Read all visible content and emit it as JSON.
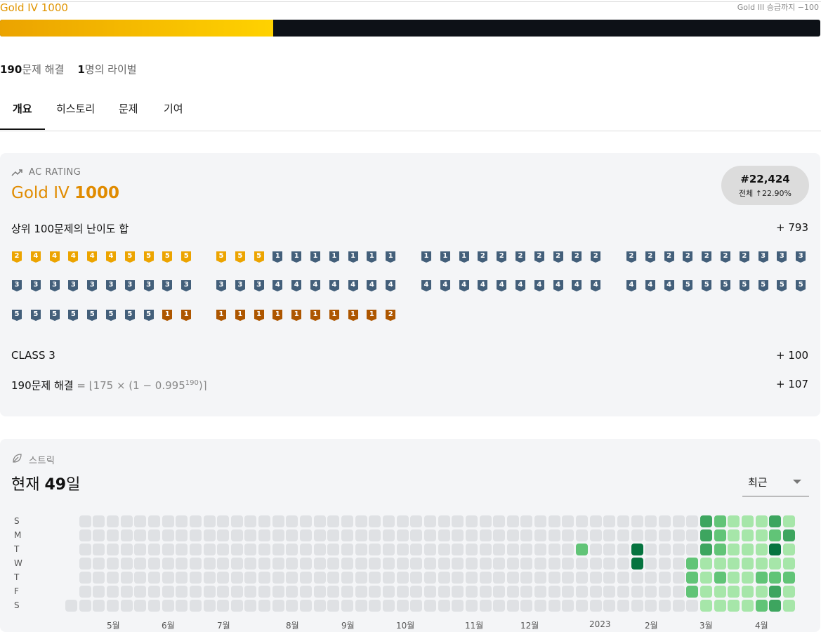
{
  "header": {
    "tier_name": "Gold IV",
    "tier_rating": "1000",
    "next_tier": "Gold III 승급까지 −100",
    "progress_fraction": 0.333,
    "solved_count": "190",
    "solved_label": "문제 해결",
    "rival_count": "1",
    "rival_label": "명의 라이벌"
  },
  "tabs": [
    {
      "label": "개요",
      "active": true
    },
    {
      "label": "히스토리",
      "active": false
    },
    {
      "label": "문제",
      "active": false
    },
    {
      "label": "기여",
      "active": false
    }
  ],
  "ac_rating": {
    "section_label": "AC RATING",
    "tier_name": "Gold IV",
    "rating": "1000",
    "rank": "#22,424",
    "percentile": "전체 ↑22.90%",
    "top100_label": "상위 100문제의 난이도 합",
    "top100_value": "+ 793",
    "class_label": "CLASS 3",
    "class_value": "+ 100",
    "solved_label": "190문제 해결",
    "solved_formula_a": " = ⌊175 × (1 − 0.995",
    "solved_formula_exp": "190",
    "solved_formula_b": ")⌉",
    "solved_value": "+ 107"
  },
  "problem_tiers": [
    [
      "G2",
      "G4",
      "G4",
      "G4",
      "G4",
      "G4",
      "G5",
      "G5",
      "G5",
      "G5",
      "G5",
      "G5",
      "G5",
      "S1",
      "S1",
      "S1",
      "S1",
      "S1",
      "S1",
      "S1",
      "S1",
      "S1",
      "S1",
      "S2",
      "S2",
      "S2",
      "S2",
      "S2",
      "S2",
      "S2",
      "S2",
      "S2",
      "S2",
      "S2",
      "S2",
      "S2",
      "S2",
      "S3",
      "S3",
      "S3"
    ],
    [
      "S3",
      "S3",
      "S3",
      "S3",
      "S3",
      "S3",
      "S3",
      "S3",
      "S3",
      "S3",
      "S3",
      "S3",
      "S3",
      "S4",
      "S4",
      "S4",
      "S4",
      "S4",
      "S4",
      "S4",
      "S4",
      "S4",
      "S4",
      "S4",
      "S4",
      "S4",
      "S4",
      "S4",
      "S4",
      "S4",
      "S4",
      "S4",
      "S4",
      "S5",
      "S5",
      "S5",
      "S5",
      "S5",
      "S5",
      "S5"
    ],
    [
      "S5",
      "S5",
      "S5",
      "S5",
      "S5",
      "S5",
      "S5",
      "S5",
      "B1",
      "B1",
      "B1",
      "B1",
      "B1",
      "B1",
      "B1",
      "B1",
      "B1",
      "B1",
      "B1",
      "B2"
    ]
  ],
  "tier_colors": {
    "G": "#eca400",
    "S": "#435f7a",
    "B": "#ad5600"
  },
  "streak": {
    "section_label": "스트릭",
    "current_prefix": "현재 ",
    "current_days": "49",
    "current_suffix": "일",
    "select_value": "최근",
    "day_labels": [
      "S",
      "M",
      "T",
      "W",
      "T",
      "F",
      "S"
    ],
    "months": [
      "5월",
      "6월",
      "7월",
      "8월",
      "9월",
      "10월",
      "11월",
      "12월",
      "2023",
      "2월",
      "3월",
      "4월"
    ],
    "levels": {
      "0": [
        0,
        0,
        0,
        0,
        0,
        0,
        0,
        0,
        0,
        0,
        0,
        0,
        0,
        0,
        0,
        0,
        0,
        0,
        0,
        0,
        0,
        0,
        0,
        0,
        0,
        0,
        0,
        0,
        0,
        0,
        0,
        0,
        0,
        0,
        0,
        0,
        0,
        0,
        0,
        0,
        0,
        0,
        0,
        0,
        0,
        0,
        0,
        0,
        0,
        0,
        0,
        0,
        0,
        0
      ],
      "cols": [
        [
          -1,
          -1,
          -1,
          -1,
          -1,
          -1,
          0
        ],
        [
          0,
          0,
          0,
          0,
          0,
          0,
          0
        ],
        [
          0,
          0,
          0,
          0,
          0,
          0,
          0
        ],
        [
          0,
          0,
          0,
          0,
          0,
          0,
          0
        ],
        [
          0,
          0,
          0,
          0,
          0,
          0,
          0
        ],
        [
          0,
          0,
          0,
          0,
          0,
          0,
          0
        ],
        [
          0,
          0,
          0,
          0,
          0,
          0,
          0
        ],
        [
          0,
          0,
          0,
          0,
          0,
          0,
          0
        ],
        [
          0,
          0,
          0,
          0,
          0,
          0,
          0
        ],
        [
          0,
          0,
          0,
          0,
          0,
          0,
          0
        ],
        [
          0,
          0,
          0,
          0,
          0,
          0,
          0
        ],
        [
          0,
          0,
          0,
          0,
          0,
          0,
          0
        ],
        [
          0,
          0,
          0,
          0,
          0,
          0,
          0
        ],
        [
          0,
          0,
          0,
          0,
          0,
          0,
          0
        ],
        [
          0,
          0,
          0,
          0,
          0,
          0,
          0
        ],
        [
          0,
          0,
          0,
          0,
          0,
          0,
          0
        ],
        [
          0,
          0,
          0,
          0,
          0,
          0,
          0
        ],
        [
          0,
          0,
          0,
          0,
          0,
          0,
          0
        ],
        [
          0,
          0,
          0,
          0,
          0,
          0,
          0
        ],
        [
          0,
          0,
          0,
          0,
          0,
          0,
          0
        ],
        [
          0,
          0,
          0,
          0,
          0,
          0,
          0
        ],
        [
          0,
          0,
          0,
          0,
          0,
          0,
          0
        ],
        [
          0,
          0,
          0,
          0,
          0,
          0,
          0
        ],
        [
          0,
          0,
          0,
          0,
          0,
          0,
          0
        ],
        [
          0,
          0,
          0,
          0,
          0,
          0,
          0
        ],
        [
          0,
          0,
          0,
          0,
          0,
          0,
          0
        ],
        [
          0,
          0,
          0,
          0,
          0,
          0,
          0
        ],
        [
          0,
          0,
          0,
          0,
          0,
          0,
          0
        ],
        [
          0,
          0,
          0,
          0,
          0,
          0,
          0
        ],
        [
          0,
          0,
          0,
          0,
          0,
          0,
          0
        ],
        [
          0,
          0,
          0,
          0,
          0,
          0,
          0
        ],
        [
          0,
          0,
          0,
          0,
          0,
          0,
          0
        ],
        [
          0,
          0,
          0,
          0,
          0,
          0,
          0
        ],
        [
          0,
          0,
          0,
          0,
          0,
          0,
          0
        ],
        [
          0,
          0,
          0,
          0,
          0,
          0,
          0
        ],
        [
          0,
          0,
          0,
          0,
          0,
          0,
          0
        ],
        [
          0,
          0,
          0,
          0,
          0,
          0,
          0
        ],
        [
          0,
          0,
          2,
          0,
          0,
          0,
          0
        ],
        [
          0,
          0,
          0,
          0,
          0,
          0,
          0
        ],
        [
          0,
          0,
          0,
          0,
          0,
          0,
          0
        ],
        [
          0,
          0,
          0,
          0,
          0,
          0,
          0
        ],
        [
          0,
          0,
          4,
          4,
          0,
          0,
          0
        ],
        [
          0,
          0,
          0,
          0,
          0,
          0,
          0
        ],
        [
          0,
          0,
          0,
          0,
          0,
          0,
          0
        ],
        [
          0,
          0,
          0,
          0,
          0,
          0,
          0
        ],
        [
          0,
          0,
          0,
          2,
          2,
          2,
          0
        ],
        [
          3,
          3,
          3,
          1,
          1,
          1,
          1
        ],
        [
          2,
          2,
          2,
          1,
          2,
          1,
          1
        ],
        [
          1,
          1,
          1,
          1,
          1,
          1,
          1
        ],
        [
          1,
          1,
          1,
          1,
          1,
          1,
          1
        ],
        [
          1,
          1,
          1,
          1,
          2,
          1,
          2
        ],
        [
          3,
          2,
          4,
          1,
          2,
          3,
          3
        ],
        [
          1,
          3,
          1,
          1,
          2,
          1,
          1
        ]
      ],
      "colors": [
        "#dfe1e4",
        "#a6e6a9",
        "#61c477",
        "#3da55f",
        "#05733f"
      ]
    }
  }
}
